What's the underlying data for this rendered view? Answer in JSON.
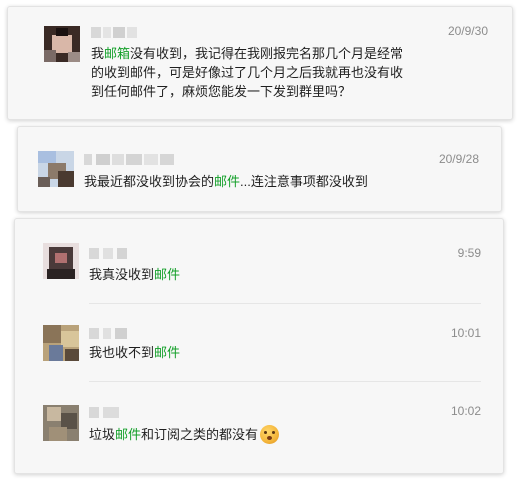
{
  "colors": {
    "highlight": "#14a02a",
    "timestamp": "#8c8c8c",
    "card_background": "#f7f7f7"
  },
  "comments": [
    {
      "time": "20/9/30",
      "text": {
        "a": "我",
        "hl": "邮箱",
        "b": "没有收到，我记得在我刚报完名那几个月是经常的收到邮件，可是好像过了几个月之后我就再也没有收到任何邮件了，麻烦您能发一下发到群里吗？"
      }
    },
    {
      "time": "20/9/28",
      "text": {
        "a": "我最近都没收到协会的",
        "hl": "邮件",
        "b": "...连注意事项都没收到"
      }
    }
  ],
  "replies": [
    {
      "time": "9:59",
      "text": {
        "a": "我真没收到",
        "hl": "邮件",
        "b": ""
      }
    },
    {
      "time": "10:01",
      "text": {
        "a": "我也收不到",
        "hl": "邮件",
        "b": ""
      }
    },
    {
      "time": "10:02",
      "text": {
        "a": "垃圾",
        "hl": "邮件",
        "b": "和订阅之类的都没有"
      },
      "emoji_icon": "shocked-face-emoji"
    }
  ]
}
